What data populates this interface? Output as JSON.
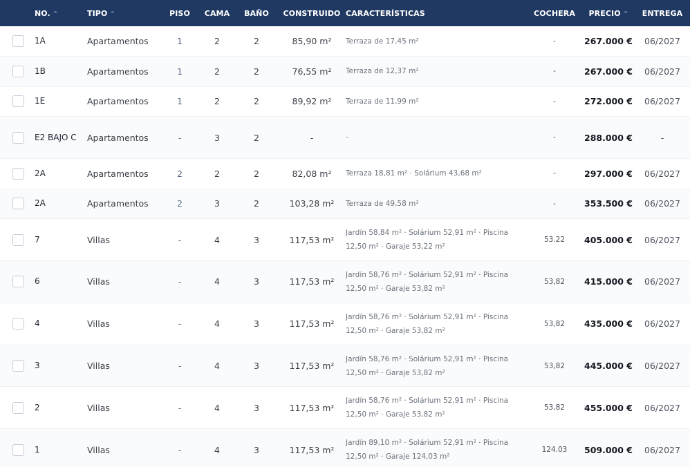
{
  "headers": {
    "no": "NO.",
    "tipo": "TIPO",
    "piso": "PISO",
    "cama": "CAMA",
    "bano": "BAÑO",
    "construido": "CONSTRUIDO",
    "caracteristicas": "CARACTERÍSTICAS",
    "cochera": "COCHERA",
    "precio": "PRECIO",
    "entrega": "ENTREGA",
    "sort_glyph": "^"
  },
  "rows": [
    {
      "no": "1A",
      "tipo": "Apartamentos",
      "piso": "1",
      "cama": "2",
      "bano": "2",
      "construido": "85,90 m²",
      "caracteristicas": "Terraza de 17,45 m²",
      "cochera": "-",
      "precio": "267.000 €",
      "entrega": "06/2027"
    },
    {
      "no": "1B",
      "tipo": "Apartamentos",
      "piso": "1",
      "cama": "2",
      "bano": "2",
      "construido": "76,55 m²",
      "caracteristicas": "Terraza de 12,37 m²",
      "cochera": "-",
      "precio": "267.000 €",
      "entrega": "06/2027"
    },
    {
      "no": "1E",
      "tipo": "Apartamentos",
      "piso": "1",
      "cama": "2",
      "bano": "2",
      "construido": "89,92 m²",
      "caracteristicas": "Terraza de 11,99 m²",
      "cochera": "-",
      "precio": "272.000 €",
      "entrega": "06/2027"
    },
    {
      "no": "E2 BAJO C",
      "tipo": "Apartamentos",
      "piso": "-",
      "cama": "3",
      "bano": "2",
      "construido": "-",
      "caracteristicas": "-",
      "cochera": "-",
      "precio": "288.000 €",
      "entrega": "-"
    },
    {
      "no": "2A",
      "tipo": "Apartamentos",
      "piso": "2",
      "cama": "2",
      "bano": "2",
      "construido": "82,08 m²",
      "caracteristicas": "Terraza 18,81 m² · Solárium 43,68 m²",
      "cochera": "-",
      "precio": "297.000 €",
      "entrega": "06/2027"
    },
    {
      "no": "2A",
      "tipo": "Apartamentos",
      "piso": "2",
      "cama": "3",
      "bano": "2",
      "construido": "103,28 m²",
      "caracteristicas": "Terraza de 49,58 m²",
      "cochera": "-",
      "precio": "353.500 €",
      "entrega": "06/2027"
    },
    {
      "no": "7",
      "tipo": "Villas",
      "piso": "-",
      "cama": "4",
      "bano": "3",
      "construido": "117,53 m²",
      "caracteristicas": "Jardín 58,84 m² · Solárium 52,91 m² · Piscina 12,50 m² · Garaje 53,22 m²",
      "cochera": "53.22",
      "precio": "405.000 €",
      "entrega": "06/2027"
    },
    {
      "no": "6",
      "tipo": "Villas",
      "piso": "-",
      "cama": "4",
      "bano": "3",
      "construido": "117,53 m²",
      "caracteristicas": "Jardín 58,76 m² · Solárium 52,91 m² · Piscina 12,50 m² · Garaje 53,82 m²",
      "cochera": "53,82",
      "precio": "415.000 €",
      "entrega": "06/2027"
    },
    {
      "no": "4",
      "tipo": "Villas",
      "piso": "-",
      "cama": "4",
      "bano": "3",
      "construido": "117,53 m²",
      "caracteristicas": "Jardín 58,76 m² · Solárium 52,91 m² · Piscina 12,50 m² · Garaje 53,82 m²",
      "cochera": "53,82",
      "precio": "435.000 €",
      "entrega": "06/2027"
    },
    {
      "no": "3",
      "tipo": "Villas",
      "piso": "-",
      "cama": "4",
      "bano": "3",
      "construido": "117,53 m²",
      "caracteristicas": "Jardín 58,76 m² · Solárium 52,91 m² · Piscina 12,50 m² · Garaje 53,82 m²",
      "cochera": "53,82",
      "precio": "445.000 €",
      "entrega": "06/2027"
    },
    {
      "no": "2",
      "tipo": "Villas",
      "piso": "-",
      "cama": "4",
      "bano": "3",
      "construido": "117,53 m²",
      "caracteristicas": "Jardín 58,76 m² · Solárium 52,91 m² · Piscina 12,50 m² · Garaje 53,82 m²",
      "cochera": "53,82",
      "precio": "455.000 €",
      "entrega": "06/2027"
    },
    {
      "no": "1",
      "tipo": "Villas",
      "piso": "-",
      "cama": "4",
      "bano": "3",
      "construido": "117,53 m²",
      "caracteristicas": "Jardín 89,10 m² · Solárium 52,91 m² · Piscina 12,50 m² · Garaje 124,03 m²",
      "cochera": "124.03",
      "precio": "509.000 €",
      "entrega": "06/2027"
    }
  ]
}
